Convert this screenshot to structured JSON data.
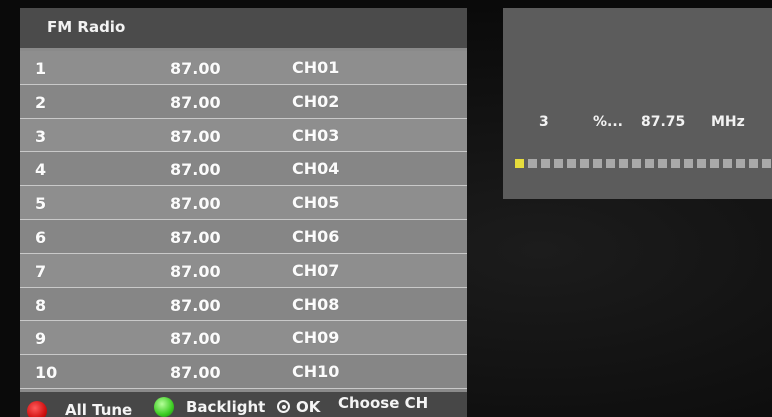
{
  "panel": {
    "title": "FM Radio",
    "channels": [
      {
        "num": "1",
        "freq": "87.00",
        "ch": "CH01"
      },
      {
        "num": "2",
        "freq": "87.00",
        "ch": "CH02"
      },
      {
        "num": "3",
        "freq": "87.00",
        "ch": "CH03"
      },
      {
        "num": "4",
        "freq": "87.00",
        "ch": "CH04"
      },
      {
        "num": "5",
        "freq": "87.00",
        "ch": "CH05"
      },
      {
        "num": "6",
        "freq": "87.00",
        "ch": "CH06"
      },
      {
        "num": "7",
        "freq": "87.00",
        "ch": "CH07"
      },
      {
        "num": "8",
        "freq": "87.00",
        "ch": "CH08"
      },
      {
        "num": "9",
        "freq": "87.00",
        "ch": "CH09"
      },
      {
        "num": "10",
        "freq": "87.00",
        "ch": "CH10"
      }
    ]
  },
  "footer": {
    "all_tune": "All Tune",
    "backlight": "Backlight",
    "ok": "OK",
    "choose": "Choose CH",
    "red_color": "#d01010",
    "green_color": "#3ccc22"
  },
  "status": {
    "channel": "3",
    "percent": "%...",
    "frequency": "87.75",
    "unit": "MHz"
  },
  "meter": {
    "filled_segments": 1,
    "total_segments": 20,
    "fill_color": "#e6dc3c"
  }
}
